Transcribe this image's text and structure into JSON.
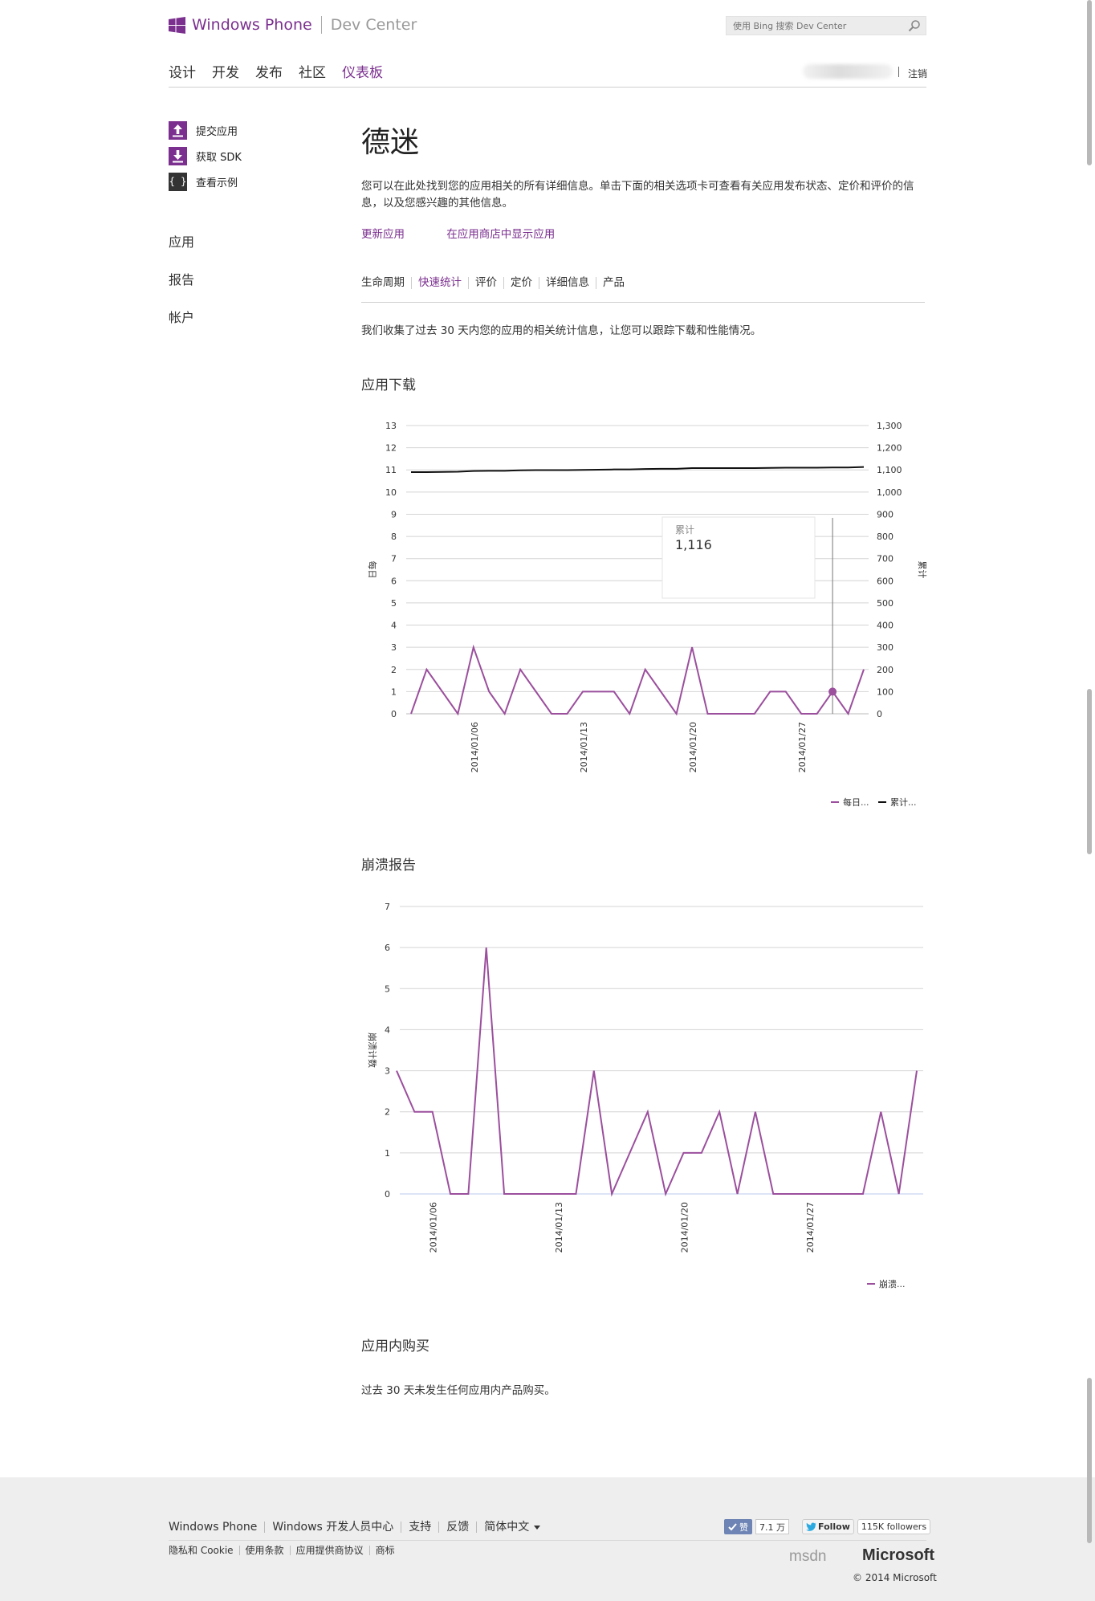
{
  "header": {
    "brand_primary": "Windows Phone",
    "brand_secondary": "Dev Center",
    "search_placeholder": "使用 Bing 搜索 Dev Center",
    "nav": [
      "设计",
      "开发",
      "发布",
      "社区",
      "仪表板"
    ],
    "nav_active_index": 4,
    "signout": "注销"
  },
  "sidebar": {
    "actions": [
      {
        "label": "提交应用",
        "icon": "upload-icon"
      },
      {
        "label": "获取 SDK",
        "icon": "download-icon"
      },
      {
        "label": "查看示例",
        "icon": "braces-icon"
      }
    ],
    "nav": [
      "应用",
      "报告",
      "帐户"
    ]
  },
  "main": {
    "title": "德迷",
    "intro": "您可以在此处找到您的应用相关的所有详细信息。单击下面的相关选项卡可查看有关应用发布状态、定价和评价的信息，以及您感兴趣的其他信息。",
    "links": [
      "更新应用",
      "在应用商店中显示应用"
    ],
    "tabs": [
      "生命周期",
      "快速统计",
      "评价",
      "定价",
      "详细信息",
      "产品"
    ],
    "active_tab_index": 1,
    "stats_note": "我们收集了过去 30 天内您的应用的相关统计信息，让您可以跟踪下载和性能情况。",
    "downloads_title": "应用下载",
    "crash_title": "崩溃报告",
    "iap_title": "应用内购买",
    "iap_note": "过去 30 天未发生任何应用内产品购买。"
  },
  "chart_data": [
    {
      "type": "line",
      "title": "",
      "ylabel_left": "每日",
      "ylabel_right": "累计",
      "ylim_left": [
        0,
        13
      ],
      "ylim_right": [
        0,
        1300
      ],
      "yticks_left": [
        "0",
        "1",
        "2",
        "3",
        "4",
        "5",
        "6",
        "7",
        "8",
        "9",
        "10",
        "11",
        "12",
        "13"
      ],
      "yticks_right": [
        "0",
        "100",
        "200",
        "300",
        "400",
        "500",
        "600",
        "700",
        "800",
        "900",
        "1,000",
        "1,100",
        "1,200",
        "1,300"
      ],
      "xticks": [
        "2014/01/06",
        "2014/01/13",
        "2014/01/20",
        "2014/01/27"
      ],
      "series": [
        {
          "name": "每日...",
          "axis": "left",
          "color": "#9b4f9d",
          "values": [
            0,
            2,
            1,
            0,
            3,
            1,
            0,
            2,
            1,
            0,
            0,
            1,
            1,
            1,
            0,
            2,
            1,
            0,
            3,
            0,
            0,
            0,
            0,
            1,
            1,
            0,
            0,
            1,
            0,
            2
          ]
        },
        {
          "name": "累计...",
          "axis": "right",
          "color": "#111111",
          "values": [
            1090,
            1090,
            1091,
            1092,
            1095,
            1096,
            1096,
            1098,
            1099,
            1099,
            1099,
            1100,
            1101,
            1102,
            1102,
            1104,
            1105,
            1105,
            1108,
            1108,
            1108,
            1108,
            1108,
            1109,
            1110,
            1110,
            1110,
            1111,
            1111,
            1113
          ]
        }
      ],
      "tooltip": {
        "label": "累计",
        "value": "1,116"
      },
      "grid": true,
      "legend": "bottom-right"
    },
    {
      "type": "line",
      "title": "",
      "ylabel": "崩溃计数",
      "ylim": [
        0,
        7
      ],
      "yticks": [
        "0",
        "1",
        "2",
        "3",
        "4",
        "5",
        "6",
        "7"
      ],
      "xticks": [
        "2014/01/06",
        "2014/01/13",
        "2014/01/20",
        "2014/01/27"
      ],
      "series": [
        {
          "name": "崩溃...",
          "color": "#9b4f9d",
          "values": [
            3,
            2,
            2,
            0,
            0,
            6,
            0,
            0,
            0,
            0,
            0,
            3,
            0,
            1,
            2,
            0,
            1,
            1,
            2,
            0,
            2,
            0,
            0,
            0,
            0,
            0,
            0,
            2,
            0,
            3
          ]
        }
      ],
      "grid": true,
      "legend": "bottom-right"
    }
  ],
  "footer": {
    "links": [
      "Windows Phone",
      "Windows 开发人员中心",
      "支持",
      "反馈",
      "简体中文"
    ],
    "legal": [
      "隐私和 Cookie",
      "使用条款",
      "应用提供商协议",
      "商标"
    ],
    "like_label": "赞",
    "like_count": "7.1 万",
    "follow_label": "Follow",
    "followers": "115K followers",
    "msdn": "msdn",
    "microsoft": "Microsoft",
    "copyright": "© 2014 Microsoft"
  }
}
